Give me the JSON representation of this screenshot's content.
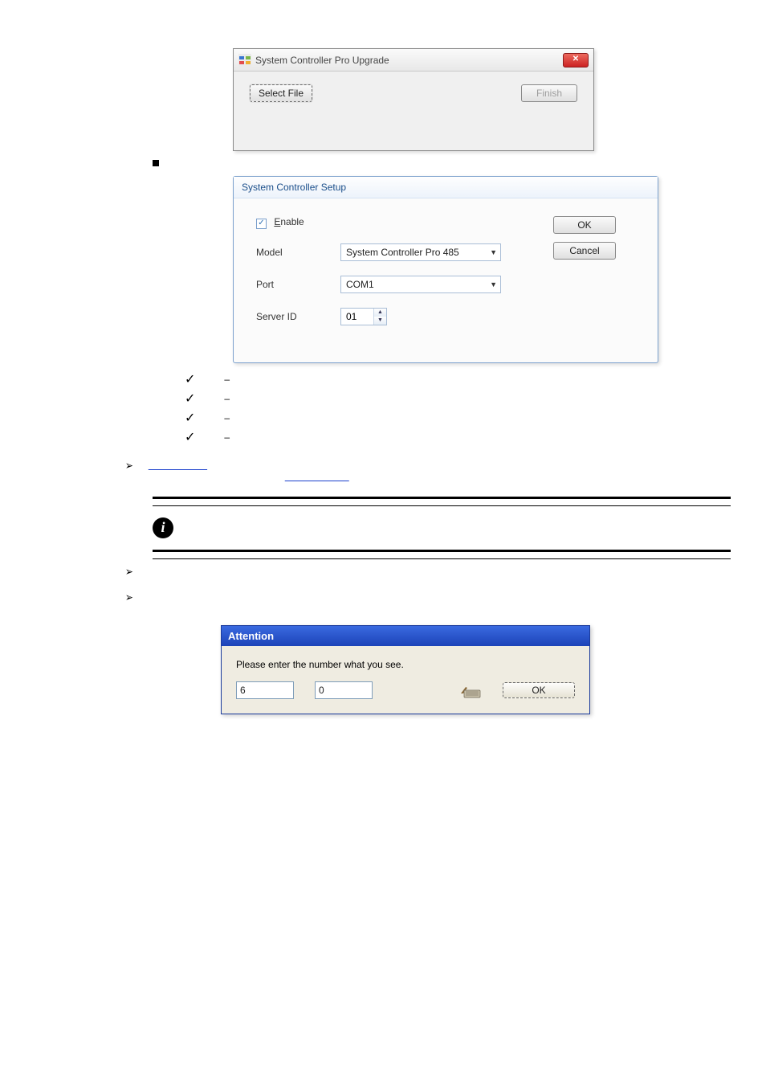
{
  "dlg1": {
    "title": "System Controller Pro Upgrade",
    "select_file_btn": "Select File",
    "finish_btn": "Finish",
    "close_btn": "✕"
  },
  "mid_bullet": {
    "text": ""
  },
  "dlg2": {
    "title": "System Controller Setup",
    "enable_label": "Enable",
    "model_label": "Model",
    "model_value": "System Controller Pro 485",
    "port_label": "Port",
    "port_value": "COM1",
    "server_id_label": "Server ID",
    "server_id_value": "01",
    "ok_btn": "OK",
    "cancel_btn": "Cancel"
  },
  "checklist": [
    {
      "term": "",
      "dash": "–",
      "rest": ""
    },
    {
      "term": "",
      "dash": "–",
      "rest": ""
    },
    {
      "term": "",
      "dash": "–",
      "rest": ""
    },
    {
      "term": "",
      "dash": "–",
      "rest": ""
    }
  ],
  "triangles": {
    "item1_text": "",
    "item1_link": "",
    "item1_text2": "",
    "item1_link2": "",
    "item2_text": "",
    "item3_text": ""
  },
  "info_note": "",
  "dlg3": {
    "title": "Attention",
    "message": "Please enter the number what you see.",
    "field1": "6",
    "field2": "0",
    "ok_btn": "OK"
  }
}
